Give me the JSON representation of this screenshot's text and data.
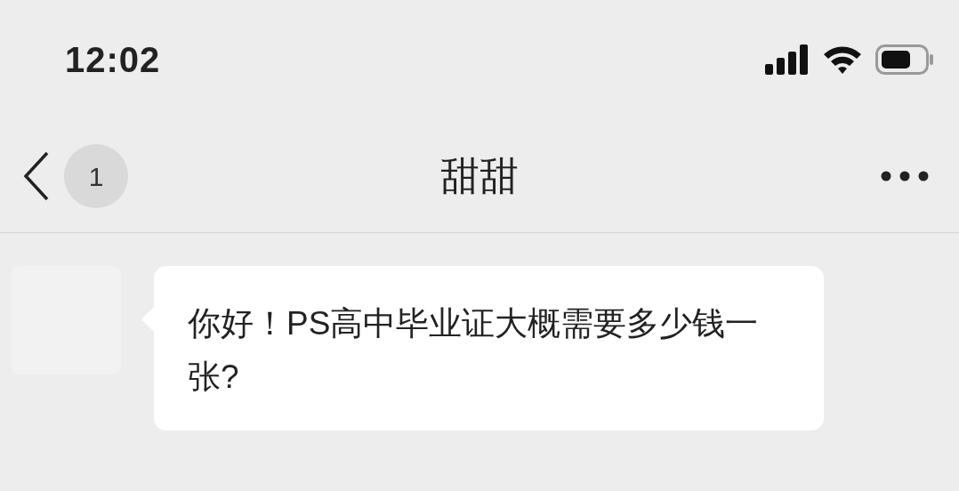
{
  "status_bar": {
    "time": "12:02"
  },
  "nav_bar": {
    "unread_badge": "1",
    "title": "甜甜"
  },
  "messages": [
    {
      "kind": "received",
      "text": "你好！PS高中毕业证大概需要多少钱一张?"
    }
  ]
}
